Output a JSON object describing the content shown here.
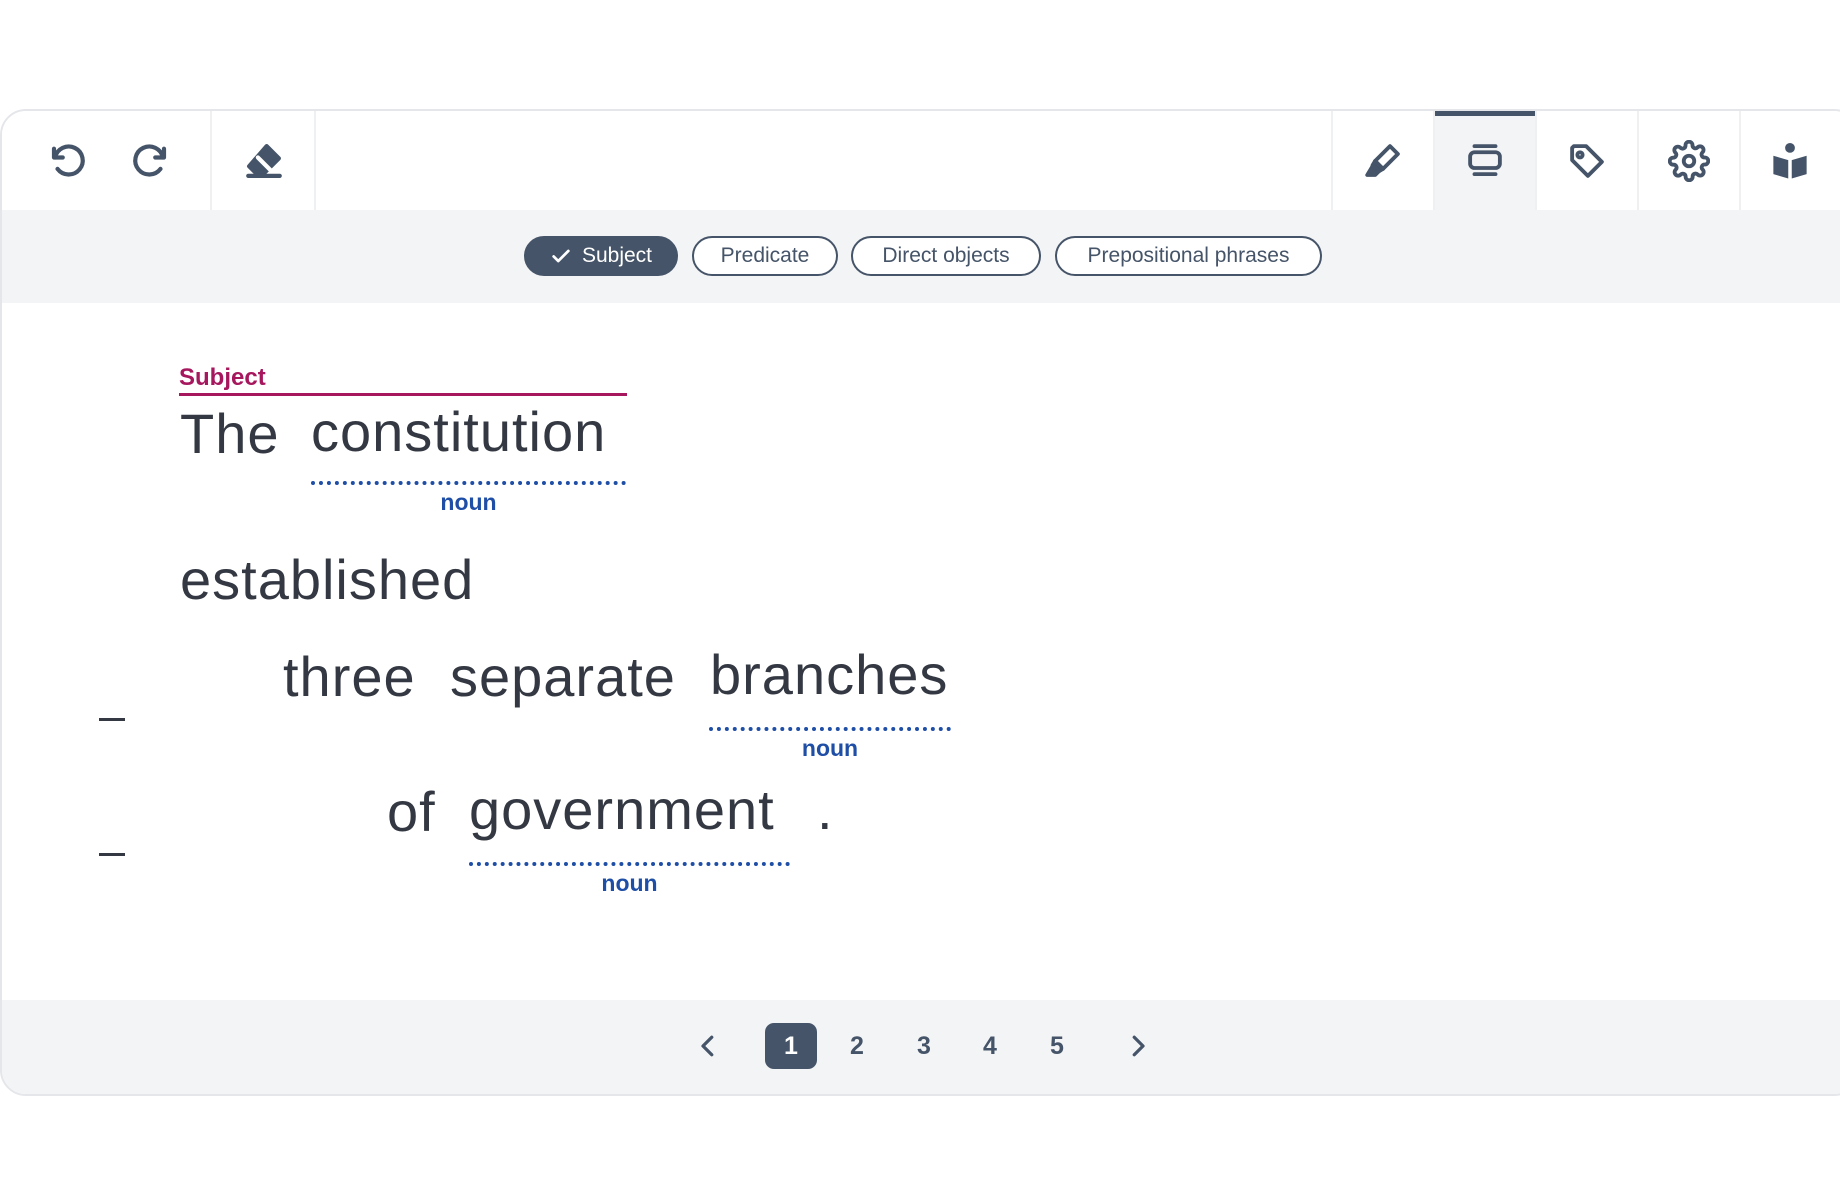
{
  "toolbar": {
    "left_tools": [
      "undo-icon",
      "redo-icon",
      "eraser-icon"
    ],
    "right_tools": [
      "highlighter-icon",
      "layers-icon",
      "tag-icon",
      "gear-icon",
      "reader-icon"
    ],
    "active_tool": "layers-icon"
  },
  "filters": {
    "chips": [
      "Subject",
      "Predicate",
      "Direct objects",
      "Prepositional phrases"
    ],
    "selected": "Subject"
  },
  "sentence": {
    "subject_label": "Subject",
    "words": {
      "the": "The",
      "constitution": "constitution",
      "established": "established",
      "three": "three",
      "separate": "separate",
      "branches": "branches",
      "of": "of",
      "government": "government",
      "period": "."
    },
    "tags": {
      "constitution": "noun",
      "branches": "noun",
      "government": "noun"
    },
    "collapse_markers": [
      "_",
      "_"
    ]
  },
  "pagination": {
    "pages": [
      "1",
      "2",
      "3",
      "4",
      "5"
    ],
    "current": "1"
  },
  "colors": {
    "accent": "#455468",
    "subject": "#a6175e",
    "noun": "#1f4ea6",
    "text": "#333842"
  }
}
